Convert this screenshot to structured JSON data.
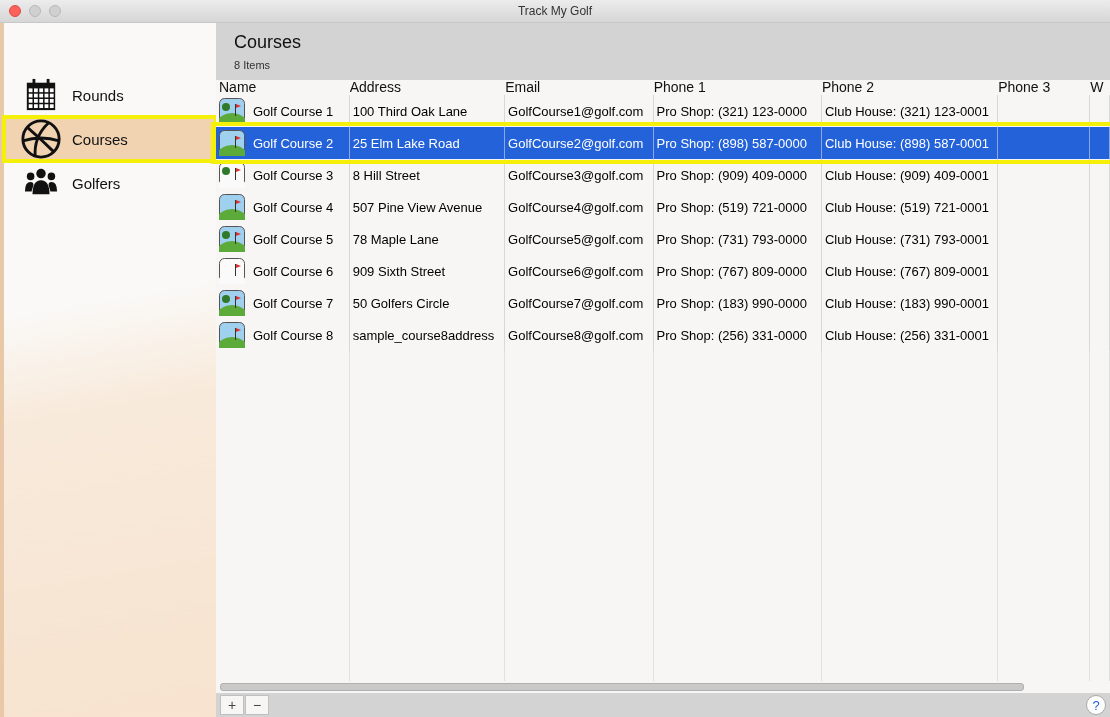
{
  "window": {
    "title": "Track My Golf"
  },
  "sidebar": {
    "items": [
      {
        "label": "Rounds",
        "kind": "calendar",
        "selected": false,
        "highlighted": false
      },
      {
        "label": "Courses",
        "kind": "globe",
        "selected": true,
        "highlighted": true
      },
      {
        "label": "Golfers",
        "kind": "people",
        "selected": false,
        "highlighted": false
      }
    ]
  },
  "header": {
    "title": "Courses",
    "subtitle": "8 Items"
  },
  "table": {
    "columns": [
      "Name",
      "Address",
      "Email",
      "Phone 1",
      "Phone 2",
      "Phone 3",
      "W"
    ],
    "rows": [
      {
        "cells": [
          "Golf Course 1",
          "100 Third Oak Lane",
          "GolfCourse1@golf.com",
          "Pro Shop: (321) 123-0000",
          "Club House: (321) 123-0001"
        ],
        "selected": false,
        "highlighted": false
      },
      {
        "cells": [
          "Golf Course 2",
          "25 Elm Lake Road",
          "GolfCourse2@golf.com",
          "Pro Shop: (898) 587-0000",
          "Club House: (898) 587-0001"
        ],
        "selected": true,
        "highlighted": true
      },
      {
        "cells": [
          "Golf Course 3",
          "8 Hill Street",
          "GolfCourse3@golf.com",
          "Pro Shop: (909) 409-0000",
          "Club House: (909) 409-0001"
        ],
        "selected": false,
        "highlighted": false
      },
      {
        "cells": [
          "Golf Course 4",
          "507 Pine View Avenue",
          "GolfCourse4@golf.com",
          "Pro Shop: (519) 721-0000",
          "Club House: (519) 721-0001"
        ],
        "selected": false,
        "highlighted": false
      },
      {
        "cells": [
          "Golf Course 5",
          "78 Maple Lane",
          "GolfCourse5@golf.com",
          "Pro Shop: (731) 793-0000",
          "Club House: (731) 793-0001"
        ],
        "selected": false,
        "highlighted": false
      },
      {
        "cells": [
          "Golf Course 6",
          "909 Sixth Street",
          "GolfCourse6@golf.com",
          "Pro Shop: (767) 809-0000",
          "Club House: (767) 809-0001"
        ],
        "selected": false,
        "highlighted": false
      },
      {
        "cells": [
          "Golf Course 7",
          "50 Golfers Circle",
          "GolfCourse7@golf.com",
          "Pro Shop: (183) 990-0000",
          "Club House: (183) 990-0001"
        ],
        "selected": false,
        "highlighted": false
      },
      {
        "cells": [
          "Golf Course 8",
          "sample_course8address",
          "GolfCourse8@golf.com",
          "Pro Shop: (256) 331-0000",
          "Club House: (256) 331-0001"
        ],
        "selected": false,
        "highlighted": false
      }
    ]
  },
  "footer": {
    "add": "+",
    "remove": "−",
    "help": "?"
  }
}
